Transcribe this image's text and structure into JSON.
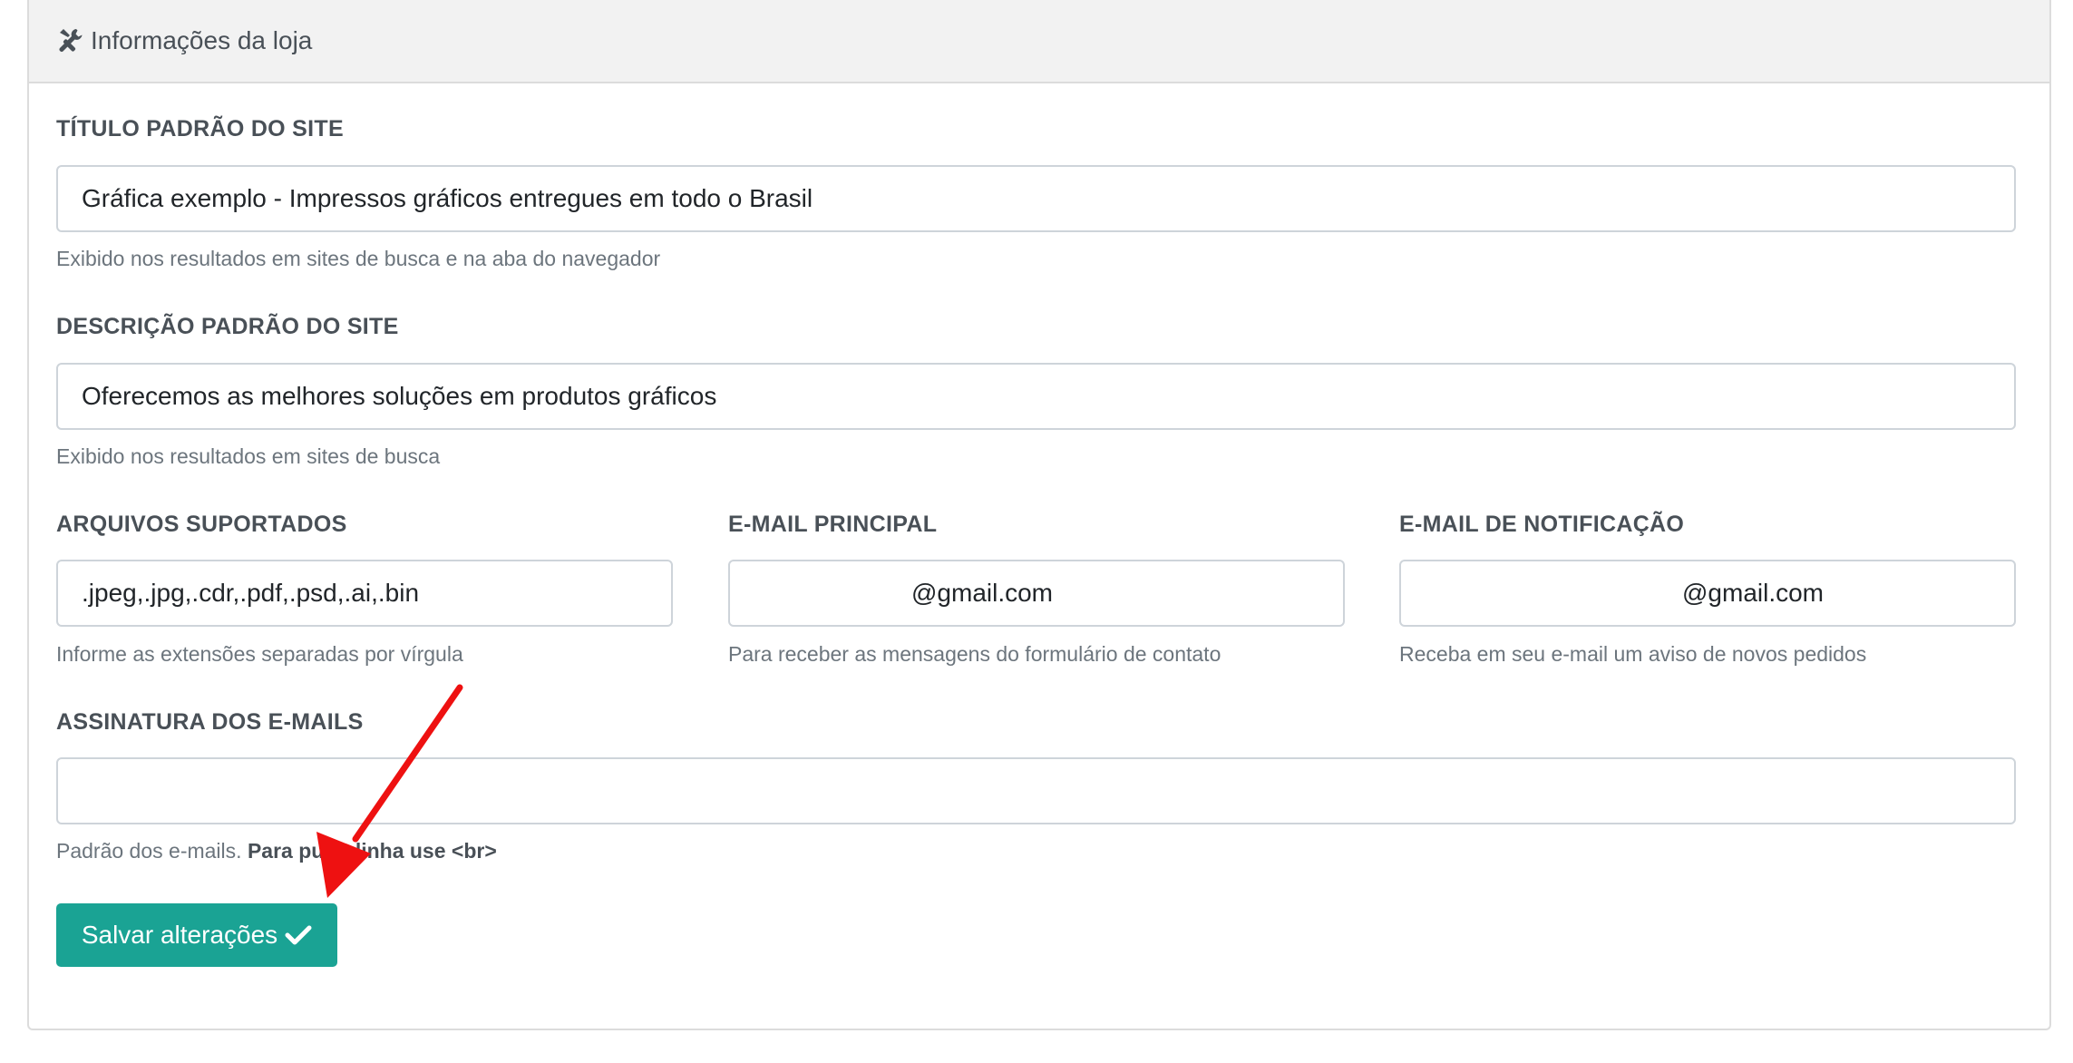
{
  "header": {
    "title": "Informações da loja",
    "icon": "tools-icon"
  },
  "fields": {
    "title": {
      "label": "TÍTULO PADRÃO DO SITE",
      "value": "Gráfica exemplo - Impressos gráficos entregues em todo o Brasil",
      "help": "Exibido nos resultados em sites de busca e na aba do navegador"
    },
    "description": {
      "label": "DESCRIÇÃO PADRÃO DO SITE",
      "value": "Oferecemos as melhores soluções em produtos gráficos",
      "help": "Exibido nos resultados em sites de busca"
    },
    "files": {
      "label": "ARQUIVOS SUPORTADOS",
      "value": ".jpeg,.jpg,.cdr,.pdf,.psd,.ai,.bin",
      "help": "Informe as extensões separadas por vírgula"
    },
    "main_email": {
      "label": "E-MAIL PRINCIPAL",
      "value": "@gmail.com",
      "help": "Para receber as mensagens do formulário de contato"
    },
    "notify_email": {
      "label": "E-MAIL DE NOTIFICAÇÃO",
      "value": "@gmail.com",
      "help": "Receba em seu e-mail um aviso de novos pedidos"
    },
    "signature": {
      "label": "ASSINATURA DOS E-MAILS",
      "value": "",
      "help_prefix": "Padrão dos e-mails.",
      "help_bold": "Para pular linha use <br>"
    }
  },
  "save_button": {
    "label": "Salvar alterações",
    "icon": "check-icon"
  },
  "annotation": {
    "icon": "red-arrow-icon",
    "color": "#ee1111"
  },
  "colors": {
    "accent": "#1aa394"
  }
}
